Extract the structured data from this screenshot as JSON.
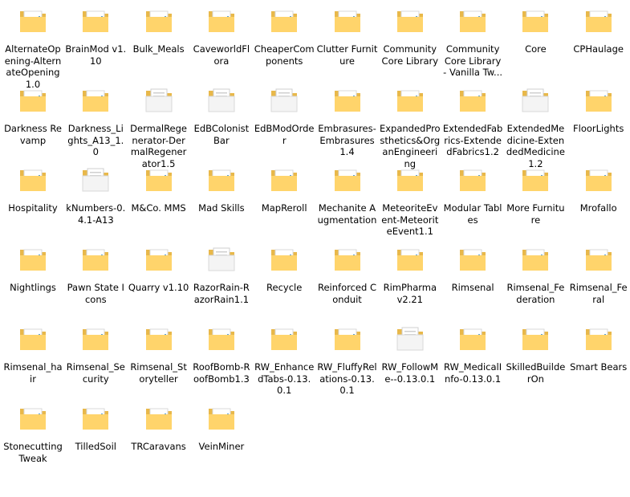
{
  "items": [
    {
      "name": "AlternateOpening-AlternateOpening1.0",
      "icon": "folder-icon"
    },
    {
      "name": "BrainMod v1.10",
      "icon": "folder-icon"
    },
    {
      "name": "Bulk_Meals",
      "icon": "folder-icon"
    },
    {
      "name": "CaveworldFlora",
      "icon": "folder-icon"
    },
    {
      "name": "CheaperComponents",
      "icon": "folder-icon"
    },
    {
      "name": "Clutter Furniture",
      "icon": "folder-icon"
    },
    {
      "name": "Community Core Library",
      "icon": "folder-icon"
    },
    {
      "name": "Community Core Library - Vanilla Tw...",
      "icon": "folder-icon"
    },
    {
      "name": "Core",
      "icon": "folder-icon"
    },
    {
      "name": "CPHaulage",
      "icon": "folder-icon"
    },
    {
      "name": "Darkness Revamp",
      "icon": "folder-icon"
    },
    {
      "name": "Darkness_Lights_A13_1.0",
      "icon": "folder-icon"
    },
    {
      "name": "DermalRegenerator-DermalRegenerator1.5",
      "icon": "folder-doc-icon"
    },
    {
      "name": "EdBColonistBar",
      "icon": "folder-doc-icon"
    },
    {
      "name": "EdBModOrder",
      "icon": "folder-doc-icon"
    },
    {
      "name": "Embrasures-Embrasures1.4",
      "icon": "folder-icon"
    },
    {
      "name": "ExpandedProsthetics&OrganEngineering",
      "icon": "folder-icon"
    },
    {
      "name": "ExtendedFabrics-ExtendedFabrics1.2",
      "icon": "folder-icon"
    },
    {
      "name": "ExtendedMedicine-ExtendedMedicine1.2",
      "icon": "folder-doc-icon"
    },
    {
      "name": "FloorLights",
      "icon": "folder-icon"
    },
    {
      "name": "Hospitality",
      "icon": "folder-icon"
    },
    {
      "name": "kNumbers-0.4.1-A13",
      "icon": "folder-doc-icon"
    },
    {
      "name": "M&Co. MMS",
      "icon": "folder-icon"
    },
    {
      "name": "Mad Skills",
      "icon": "folder-icon"
    },
    {
      "name": "MapReroll",
      "icon": "folder-icon"
    },
    {
      "name": "Mechanite Augmentation",
      "icon": "folder-icon"
    },
    {
      "name": "MeteoriteEvent-MeteoriteEvent1.1",
      "icon": "folder-icon"
    },
    {
      "name": "Modular Tables",
      "icon": "folder-icon"
    },
    {
      "name": "More Furniture",
      "icon": "folder-icon"
    },
    {
      "name": "Mrofallo",
      "icon": "folder-icon"
    },
    {
      "name": "Nightlings",
      "icon": "folder-icon"
    },
    {
      "name": "Pawn State Icons",
      "icon": "folder-icon"
    },
    {
      "name": "Quarry v1.10",
      "icon": "folder-icon"
    },
    {
      "name": "RazorRain-RazorRain1.1",
      "icon": "folder-doc-icon"
    },
    {
      "name": "Recycle",
      "icon": "folder-icon"
    },
    {
      "name": "Reinforced Conduit",
      "icon": "folder-icon"
    },
    {
      "name": "RimPharma v2.21",
      "icon": "folder-icon"
    },
    {
      "name": "Rimsenal",
      "icon": "folder-icon"
    },
    {
      "name": "Rimsenal_Federation",
      "icon": "folder-icon"
    },
    {
      "name": "Rimsenal_Feral",
      "icon": "folder-icon"
    },
    {
      "name": "Rimsenal_hair",
      "icon": "folder-icon"
    },
    {
      "name": "Rimsenal_Security",
      "icon": "folder-icon"
    },
    {
      "name": "Rimsenal_Storyteller",
      "icon": "folder-icon"
    },
    {
      "name": "RoofBomb-RoofBomb1.3",
      "icon": "folder-icon"
    },
    {
      "name": "RW_EnhancedTabs-0.13.0.1",
      "icon": "folder-icon"
    },
    {
      "name": "RW_FluffyRelations-0.13.0.1",
      "icon": "folder-icon"
    },
    {
      "name": "RW_FollowMe--0.13.0.1",
      "icon": "folder-doc-icon"
    },
    {
      "name": "RW_MedicalInfo-0.13.0.1",
      "icon": "folder-icon"
    },
    {
      "name": "SkilledBuilderOn",
      "icon": "folder-icon"
    },
    {
      "name": "Smart Bears",
      "icon": "folder-icon"
    },
    {
      "name": "Stonecutting Tweak",
      "icon": "folder-icon"
    },
    {
      "name": "TilledSoil",
      "icon": "folder-icon"
    },
    {
      "name": "TRCaravans",
      "icon": "folder-icon"
    },
    {
      "name": "VeinMiner",
      "icon": "folder-icon"
    }
  ],
  "colors": {
    "folder_back": "#e8b84a",
    "folder_front": "#ffd46b",
    "paper": "#ffffff",
    "doc_paper": "#f4f4f4"
  }
}
